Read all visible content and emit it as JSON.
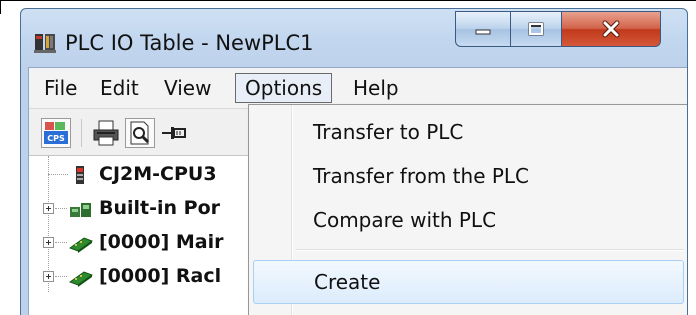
{
  "window": {
    "title": "PLC IO Table - NewPLC1",
    "icon": "plc-io-table-app-icon",
    "controls": {
      "minimize": "minimize-icon",
      "maximize": "maximize-icon",
      "close": "close-icon"
    }
  },
  "menubar": {
    "items": [
      {
        "label": "File"
      },
      {
        "label": "Edit"
      },
      {
        "label": "View"
      },
      {
        "label": "Options",
        "open": true
      },
      {
        "label": "Help"
      }
    ]
  },
  "toolbar": {
    "buttons": [
      {
        "icon": "cps-icon",
        "caption": "CPS"
      },
      {
        "icon": "print-icon"
      },
      {
        "icon": "print-preview-icon"
      },
      {
        "icon": "pin-icon"
      }
    ]
  },
  "tree": {
    "nodes": [
      {
        "label": "CJ2M-CPU3",
        "icon": "cpu-unit-icon",
        "expandable": false
      },
      {
        "label": "Built-in Por",
        "icon": "built-in-port-icon",
        "expandable": true
      },
      {
        "label": "[0000] Mair",
        "icon": "rack-icon",
        "expandable": true
      },
      {
        "label": "[0000] Racl",
        "icon": "rack-icon",
        "expandable": true
      }
    ]
  },
  "options_menu": {
    "items": [
      {
        "label": "Transfer to PLC"
      },
      {
        "label": "Transfer from the PLC"
      },
      {
        "label": "Compare with PLC"
      },
      {
        "label": "Create",
        "highlighted": true
      }
    ]
  },
  "colors": {
    "titlebar": "#c2d7ef",
    "close_button": "#c8442a",
    "menu_highlight": "#dcecfc"
  }
}
